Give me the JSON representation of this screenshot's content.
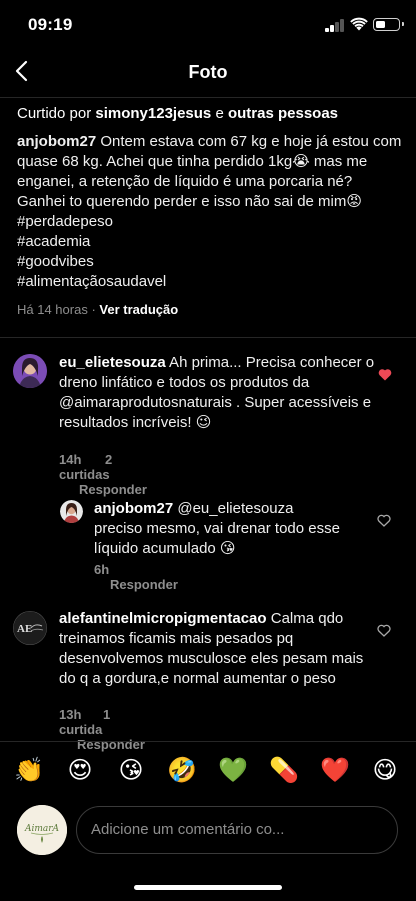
{
  "status": {
    "time": "09:19"
  },
  "nav": {
    "title": "Foto"
  },
  "post": {
    "likes_prefix": "Curtido por ",
    "likes_user": "simony123jesus",
    "likes_mid": " e ",
    "likes_rest": "outras pessoas",
    "author": "anjobom27",
    "caption": " Ontem estava com 67 kg e hoje já estou com quase 68 kg. Achei que tinha perdido 1kg😭 mas me enganei, a retenção de líquido é uma porcaria né?\nGanhei to querendo perder e isso não sai de mim😡\n#perdadepeso\n#academia\n#goodvibes\n#alimentaçãosaudavel",
    "time_ago": "Há 14 horas",
    "separator": "·",
    "translate": "Ver tradução"
  },
  "comments": [
    {
      "user": "eu_elietesouza",
      "text": " Ah prima... Precisa conhecer o dreno linfático e todos os produtos da @aimaraprodutosnaturais . Super acessíveis e resultados incríveis! 😉",
      "time": "14h",
      "likes": "2 curtidas",
      "reply": "Responder",
      "liked": true
    },
    {
      "user": "anjobom27",
      "text": " @eu_elietesouza preciso mesmo, vai drenar todo esse líquido acumulado 😘",
      "time": "6h",
      "likes": "",
      "reply": "Responder",
      "liked": false
    },
    {
      "user": "alefantinelmicropigmentacao",
      "text": " Calma qdo treinamos ficamis mais pesados pq desenvolvemos musculosce eles pesam mais do q a gordura,e normal aumentar o peso",
      "time": "13h",
      "likes": "1 curtida",
      "reply": "Responder",
      "liked": false
    }
  ],
  "emoji_bar": [
    "👏",
    "😍",
    "😘",
    "🤣",
    "💚",
    "💊",
    "❤️",
    "😋"
  ],
  "input": {
    "placeholder": "Adicione um comentário co...",
    "avatar_text": "AimarA"
  },
  "colors": {
    "background": "#000000",
    "muted": "#8e8e8e",
    "like_red": "#ed4956"
  }
}
